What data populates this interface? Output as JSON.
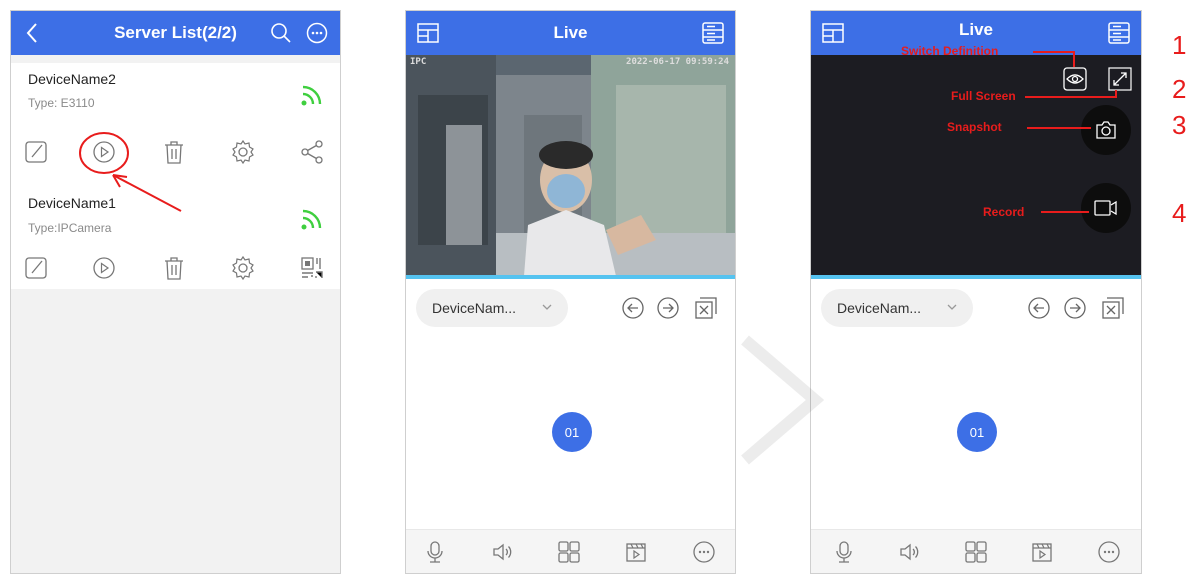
{
  "colors": {
    "accent": "#3d6fe6",
    "signal": "#3fcf3f",
    "annotation": "#e81c1c",
    "live_bar": "#55c3f0"
  },
  "server_list": {
    "title": "Server List(2/2)",
    "devices": [
      {
        "name": "DeviceName2",
        "type": "Type: E3110",
        "actions": [
          "edit-icon",
          "play-icon",
          "trash-icon",
          "gear-icon",
          "share-icon"
        ]
      },
      {
        "name": "DeviceName1",
        "type": "Type:IPCamera",
        "actions": [
          "edit-icon",
          "play-icon",
          "trash-icon",
          "gear-icon",
          "qr-code-icon"
        ]
      }
    ]
  },
  "live": {
    "title": "Live",
    "osd_label": "IPC",
    "osd_time": "2022-06-17 09:59:24",
    "device_selector": "DeviceNam...",
    "channel": "01"
  },
  "live_annotated": {
    "title": "Live",
    "device_selector": "DeviceNam...",
    "channel": "01",
    "annotations": {
      "switch_definition": "Switch Definition",
      "full_screen": "Full Screen",
      "snapshot": "Snapshot",
      "record": "Record"
    }
  },
  "step_numbers": [
    "1",
    "2",
    "3",
    "4"
  ]
}
